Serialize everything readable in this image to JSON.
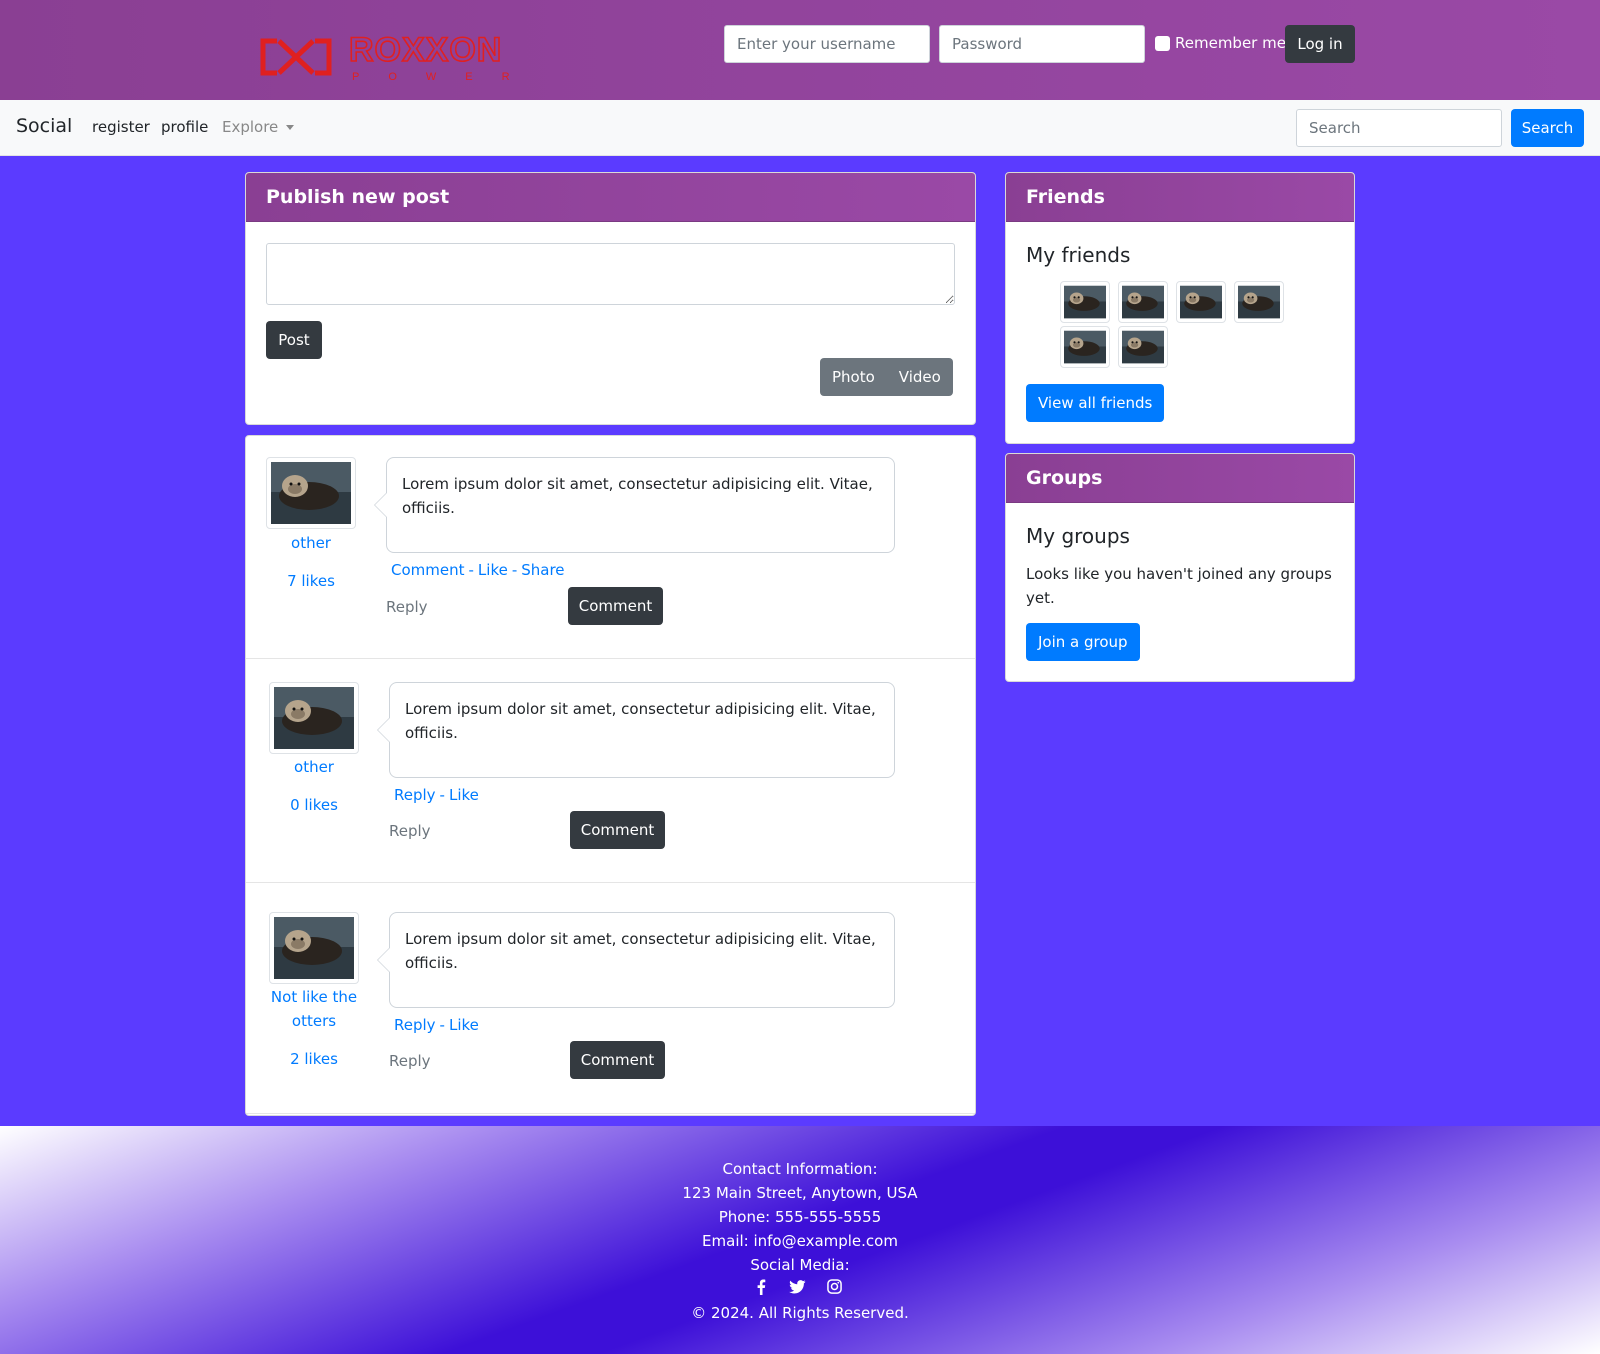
{
  "header": {
    "logo_text": "ROXXON",
    "logo_sub": "POWER",
    "username_placeholder": "Enter your username",
    "password_placeholder": "Password",
    "remember_label": "Remember me",
    "login_label": "Log in"
  },
  "navbar": {
    "brand": "Social",
    "links": [
      "register",
      "profile"
    ],
    "explore_label": "Explore",
    "search_placeholder": "Search",
    "search_button": "Search"
  },
  "publish": {
    "title": "Publish new post",
    "post_button": "Post",
    "media_buttons": [
      "Photo",
      "Video"
    ]
  },
  "posts": [
    {
      "author": "other",
      "likes": "7 likes",
      "text": "Lorem ipsum dolor sit amet, consectetur adipisicing elit. Vitae, officiis.",
      "actions": [
        "Comment",
        "Like",
        "Share"
      ],
      "reply_label": "Reply",
      "comment_button": "Comment"
    },
    {
      "author": "other",
      "likes": "0 likes",
      "text": "Lorem ipsum dolor sit amet, consectetur adipisicing elit. Vitae, officiis.",
      "actions": [
        "Reply",
        "Like"
      ],
      "reply_label": "Reply",
      "comment_button": "Comment"
    },
    {
      "author": "Not like the otters",
      "likes": "2 likes",
      "text": "Lorem ipsum dolor sit amet, consectetur adipisicing elit. Vitae, officiis.",
      "actions": [
        "Reply",
        "Like"
      ],
      "reply_label": "Reply",
      "comment_button": "Comment"
    }
  ],
  "friends": {
    "title": "Friends",
    "subtitle": "My friends",
    "count_shown": 6,
    "view_all": "View all friends"
  },
  "groups": {
    "title": "Groups",
    "subtitle": "My groups",
    "empty_text": "Looks like you haven't joined any groups yet.",
    "join_button": "Join a group"
  },
  "footer": {
    "contact_title": "Contact Information:",
    "address": "123 Main Street, Anytown, USA",
    "phone": "Phone: 555-555-5555",
    "email": "Email: info@example.com",
    "social_title": "Social Media:",
    "social_icons": [
      "facebook-icon",
      "twitter-icon",
      "instagram-icon"
    ],
    "copyright": "© 2024. All Rights Reserved."
  },
  "colors": {
    "header_purple": "#9a49a6",
    "page_background": "#5b3bff",
    "primary_blue": "#007bff",
    "dark_button": "#343a40",
    "logo_red": "#e02020"
  }
}
